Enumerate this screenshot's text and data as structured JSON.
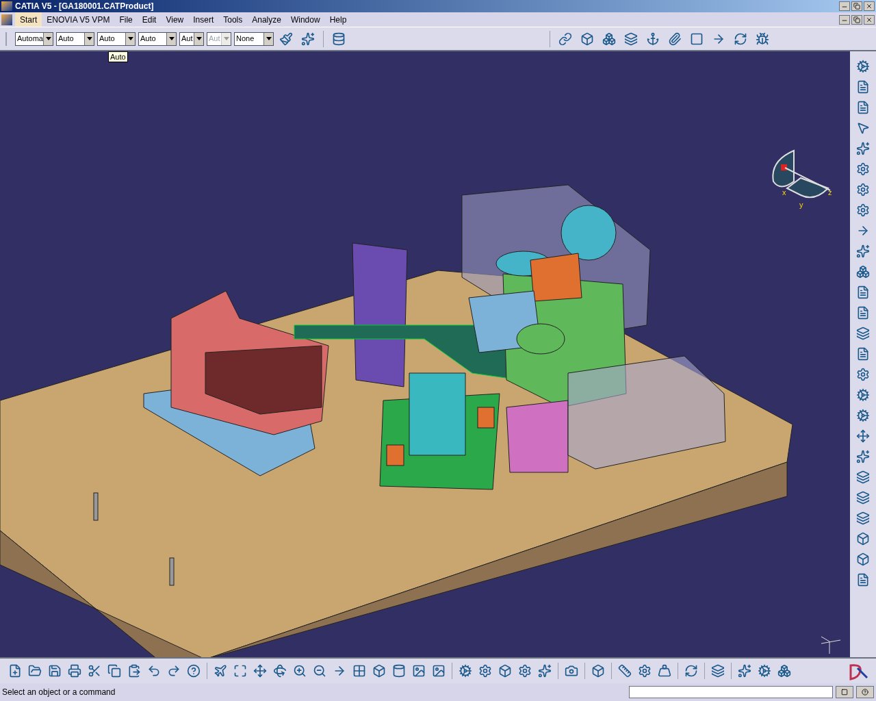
{
  "window": {
    "title": "CATIA V5 - [GA180001.CATProduct]"
  },
  "menu": [
    {
      "label": "Start",
      "selected": true
    },
    {
      "label": "ENOVIA V5 VPM",
      "selected": false
    },
    {
      "label": "File",
      "selected": false
    },
    {
      "label": "Edit",
      "selected": false
    },
    {
      "label": "View",
      "selected": false
    },
    {
      "label": "Insert",
      "selected": false
    },
    {
      "label": "Tools",
      "selected": false
    },
    {
      "label": "Analyze",
      "selected": false
    },
    {
      "label": "Window",
      "selected": false
    },
    {
      "label": "Help",
      "selected": false
    }
  ],
  "graphic_properties": [
    {
      "value": "Automa",
      "disabled": false
    },
    {
      "value": "Auto",
      "disabled": false
    },
    {
      "value": "Auto",
      "disabled": false
    },
    {
      "value": "Auto",
      "disabled": false
    },
    {
      "value": "Aut",
      "disabled": false
    },
    {
      "value": "Aut",
      "disabled": true
    },
    {
      "value": "None",
      "disabled": false
    }
  ],
  "tooltip": "Auto",
  "compass": {
    "labels": [
      "x",
      "y",
      "z"
    ]
  },
  "status_bar": {
    "message": "Select an object or a command"
  }
}
